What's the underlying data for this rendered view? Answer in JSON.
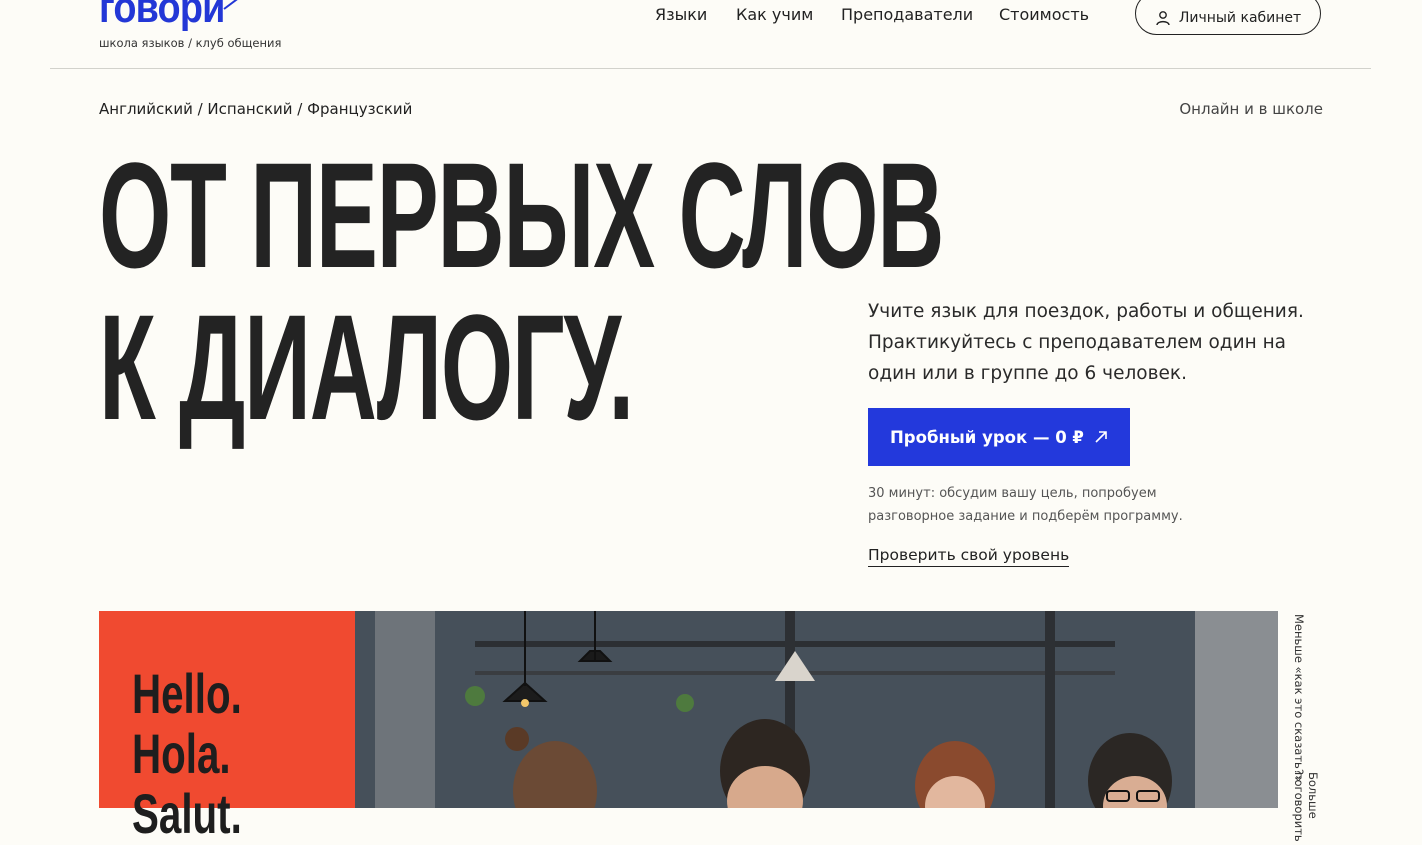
{
  "header": {
    "logo_text": "говори",
    "logo_subtitle": "школа языков / клуб общения",
    "nav": [
      "Языки",
      "Как учим",
      "Преподаватели",
      "Стоимость"
    ],
    "cabinet_label": "Личный кабинет",
    "cabinet_icon": "user-icon"
  },
  "meta": {
    "languages": "Английский / Испанский / Французский",
    "format": "Онлайн и в школе"
  },
  "hero": {
    "line1": "ОТ ПЕРВЫХ СЛОВ",
    "line2": "К ДИАЛОГУ.",
    "lead": "Учите язык для поездок, работы и общения. Практикуйтесь с преподавателем один на один или в группе до 6 человек.",
    "cta_label": "Пробный урок — 0 ₽",
    "cta_icon": "arrow-up-right-icon",
    "note": "30 минут: обсудим вашу цель, попробуем разговорное задание и подберём программу.",
    "level_link": "Проверить свой уровень"
  },
  "gallery": {
    "greetings": [
      "Hello.",
      "Hola.",
      "Salut."
    ],
    "side_text_1": "Меньше «как это сказать?»",
    "side_text_2": "Больше поговорить"
  },
  "colors": {
    "brand_blue": "#2339dc",
    "accent_red": "#f04a30",
    "background": "#fdfcf7",
    "text": "#222222"
  }
}
